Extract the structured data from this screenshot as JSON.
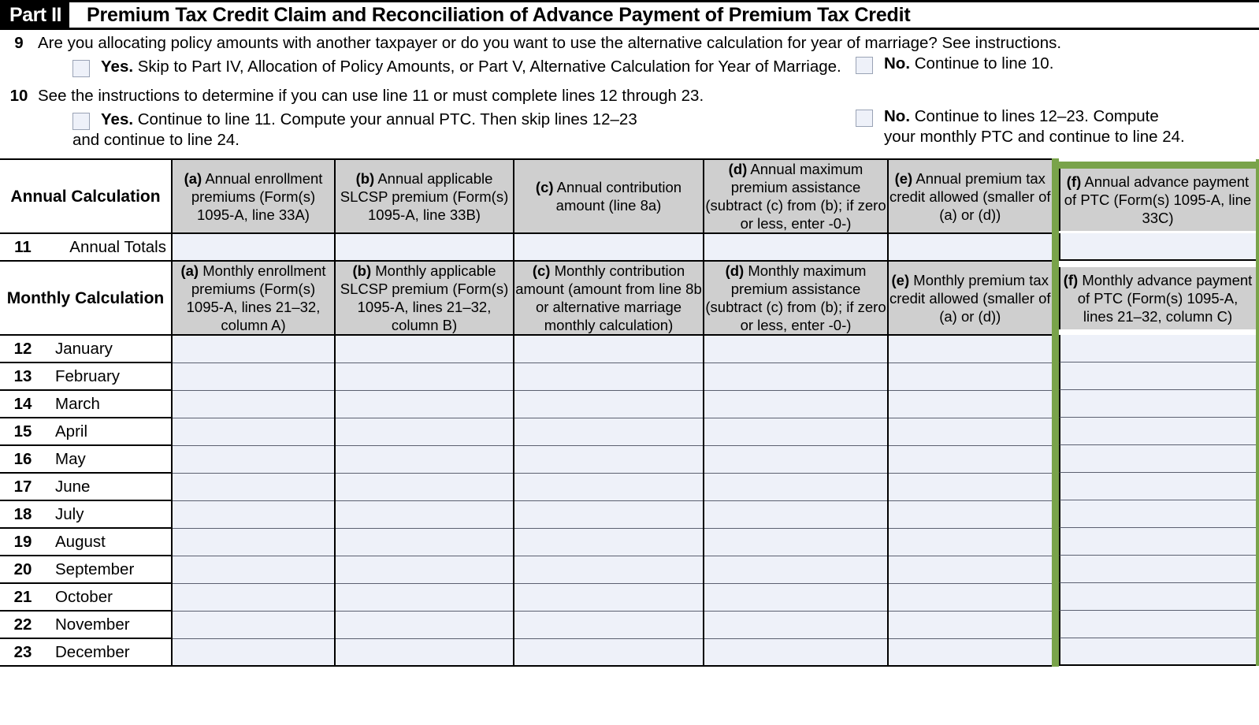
{
  "part": {
    "badge": "Part II",
    "title": "Premium Tax Credit Claim and Reconciliation of Advance Payment of Premium Tax Credit"
  },
  "questions": [
    {
      "number": "9",
      "text": "Are you allocating policy amounts with another taxpayer or do you want to use the alternative calculation for year of marriage? See instructions.",
      "yes_bold": "Yes.",
      "yes_text": "Skip to Part IV, Allocation of Policy Amounts, or Part V, Alternative Calculation for Year of Marriage.",
      "no_bold": "No.",
      "no_text": "Continue to line 10."
    },
    {
      "number": "10",
      "text": "See the instructions to determine if you can use line 11 or must complete lines 12 through 23.",
      "yes_bold": "Yes.",
      "yes_text": "Continue to line 11. Compute your annual PTC. Then skip lines 12–23",
      "yes_text_line2": "and continue to line 24.",
      "no_bold": "No.",
      "no_text": "Continue to lines 12–23. Compute",
      "no_text_line2": "your monthly PTC and continue to line 24."
    }
  ],
  "annual": {
    "row_label": "Annual Calculation",
    "columns": [
      {
        "tag": "(a)",
        "text": "Annual enrollment premiums (Form(s) 1095-A, line 33A)"
      },
      {
        "tag": "(b)",
        "text": "Annual applicable SLCSP premium (Form(s) 1095-A, line 33B)"
      },
      {
        "tag": "(c)",
        "text": "Annual contribution amount (line 8a)"
      },
      {
        "tag": "(d)",
        "text": "Annual maximum premium assistance (subtract (c) from (b); if zero or less, enter -0-)"
      },
      {
        "tag": "(e)",
        "text": "Annual premium tax credit allowed (smaller of (a) or (d))"
      },
      {
        "tag": "(f)",
        "text": "Annual advance payment of PTC (Form(s) 1095-A, line 33C)"
      }
    ],
    "totals_row": {
      "number": "11",
      "label": "Annual Totals"
    }
  },
  "monthly": {
    "row_label": "Monthly Calculation",
    "columns": [
      {
        "tag": "(a)",
        "text": "Monthly enrollment premiums (Form(s) 1095-A, lines 21–32, column A)"
      },
      {
        "tag": "(b)",
        "text": "Monthly applicable SLCSP premium (Form(s) 1095-A, lines 21–32, column B)"
      },
      {
        "tag": "(c)",
        "text": "Monthly contribution amount (amount from line 8b or alternative marriage monthly calculation)"
      },
      {
        "tag": "(d)",
        "text": "Monthly maximum premium assistance (subtract (c) from (b); if zero or less, enter -0-)"
      },
      {
        "tag": "(e)",
        "text": "Monthly premium tax credit allowed (smaller of (a) or (d))"
      },
      {
        "tag": "(f)",
        "text": "Monthly advance payment of PTC (Form(s) 1095-A, lines 21–32, column C)"
      }
    ],
    "rows": [
      {
        "number": "12",
        "label": "January"
      },
      {
        "number": "13",
        "label": "February"
      },
      {
        "number": "14",
        "label": "March"
      },
      {
        "number": "15",
        "label": "April"
      },
      {
        "number": "16",
        "label": "May"
      },
      {
        "number": "17",
        "label": "June"
      },
      {
        "number": "18",
        "label": "July"
      },
      {
        "number": "19",
        "label": "August"
      },
      {
        "number": "20",
        "label": "September"
      },
      {
        "number": "21",
        "label": "October"
      },
      {
        "number": "22",
        "label": "November"
      },
      {
        "number": "23",
        "label": "December"
      }
    ]
  },
  "colors": {
    "highlight": "#79a34a",
    "header_fill": "#cfcfcf",
    "input_fill": "#eef1f9"
  }
}
